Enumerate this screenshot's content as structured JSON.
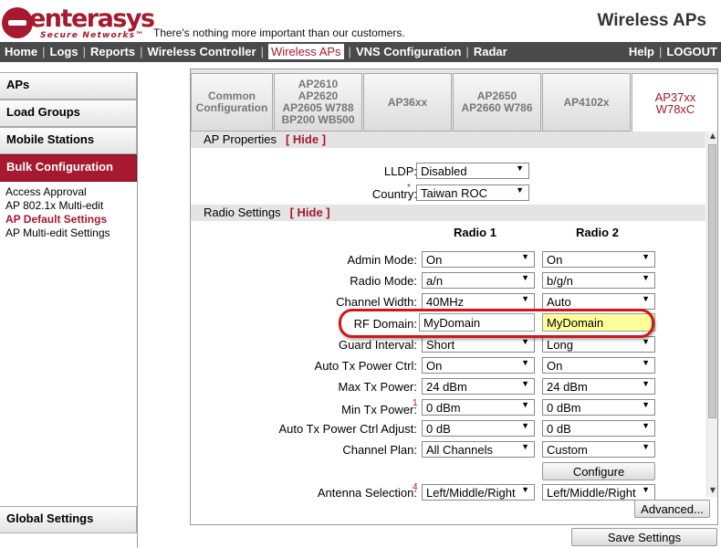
{
  "header": {
    "brand": "enterasys",
    "brand_sub": "Secure Networks",
    "tm": "™",
    "tagline": "There's nothing more important than our customers.",
    "app_title": "Wireless APs"
  },
  "nav": {
    "items": [
      "Home",
      "Logs",
      "Reports",
      "Wireless Controller",
      "Wireless APs",
      "VNS Configuration",
      "Radar"
    ],
    "right_items": [
      "Help",
      "LOGOUT"
    ],
    "separator": "|"
  },
  "sidebar": {
    "aps": "APs",
    "load_groups": "Load Groups",
    "mobile_stations": "Mobile Stations",
    "bulk_configuration": "Bulk Configuration",
    "links": [
      "Access Approval",
      "AP 802.1x Multi-edit",
      "AP Default Settings",
      "AP Multi-edit Settings"
    ],
    "global_settings": "Global Settings"
  },
  "tabs": [
    {
      "lines": [
        "Common",
        "Configuration"
      ]
    },
    {
      "lines": [
        "AP2610",
        "AP2620",
        "AP2605 W788",
        "BP200 WB500"
      ]
    },
    {
      "lines": [
        "AP36xx"
      ]
    },
    {
      "lines": [
        "AP2650",
        "AP2660 W786"
      ]
    },
    {
      "lines": [
        "AP4102x"
      ]
    },
    {
      "lines": [
        "AP37xx",
        "W78xC"
      ]
    }
  ],
  "ap_properties": {
    "title": "AP Properties",
    "hide": "[ Hide ]",
    "lldp_label": "LLDP:",
    "lldp_value": "Disabled",
    "country_label": "Country:",
    "country_req": "*",
    "country_value": "Taiwan ROC"
  },
  "radio_settings": {
    "title": "Radio Settings",
    "hide": "[ Hide ]",
    "radio1": "Radio 1",
    "radio2": "Radio 2",
    "rows": [
      {
        "label": "Admin Mode:",
        "r1": "On",
        "r2": "On"
      },
      {
        "label": "Radio Mode:",
        "r1": "a/n",
        "r2": "b/g/n"
      },
      {
        "label": "Channel Width:",
        "r1": "40MHz",
        "r2": "Auto"
      },
      {
        "label": "RF Domain:",
        "r1": "MyDomain",
        "r2": "MyDomain"
      },
      {
        "label": "Guard Interval:",
        "r1": "Short",
        "r2": "Long"
      },
      {
        "label": "Auto Tx Power Ctrl:",
        "r1": "On",
        "r2": "On"
      },
      {
        "label": "Max Tx Power:",
        "r1": "24 dBm",
        "r2": "24 dBm"
      },
      {
        "label": "Min Tx Power:",
        "sup": "1",
        "r1": "0 dBm",
        "r2": "0 dBm"
      },
      {
        "label": "Auto Tx Power Ctrl Adjust:",
        "r1": "0 dB",
        "r2": "0 dB"
      },
      {
        "label": "Channel Plan:",
        "r1": "All Channels",
        "r2": "Custom"
      },
      {
        "label": "Antenna Selection:",
        "sup": "4",
        "r1": "Left/Middle/Right",
        "r2": "Left/Middle/Right"
      }
    ],
    "configure": "Configure"
  },
  "buttons": {
    "advanced": "Advanced...",
    "save": "Save Settings"
  },
  "glyphs": {
    "dropdown": "▼",
    "scroll_up": "▲",
    "scroll_down": "▼"
  },
  "colors": {
    "brand": "#a6192e",
    "highlight": "#d0161c",
    "rf_domain_bg": "#ffff99"
  }
}
